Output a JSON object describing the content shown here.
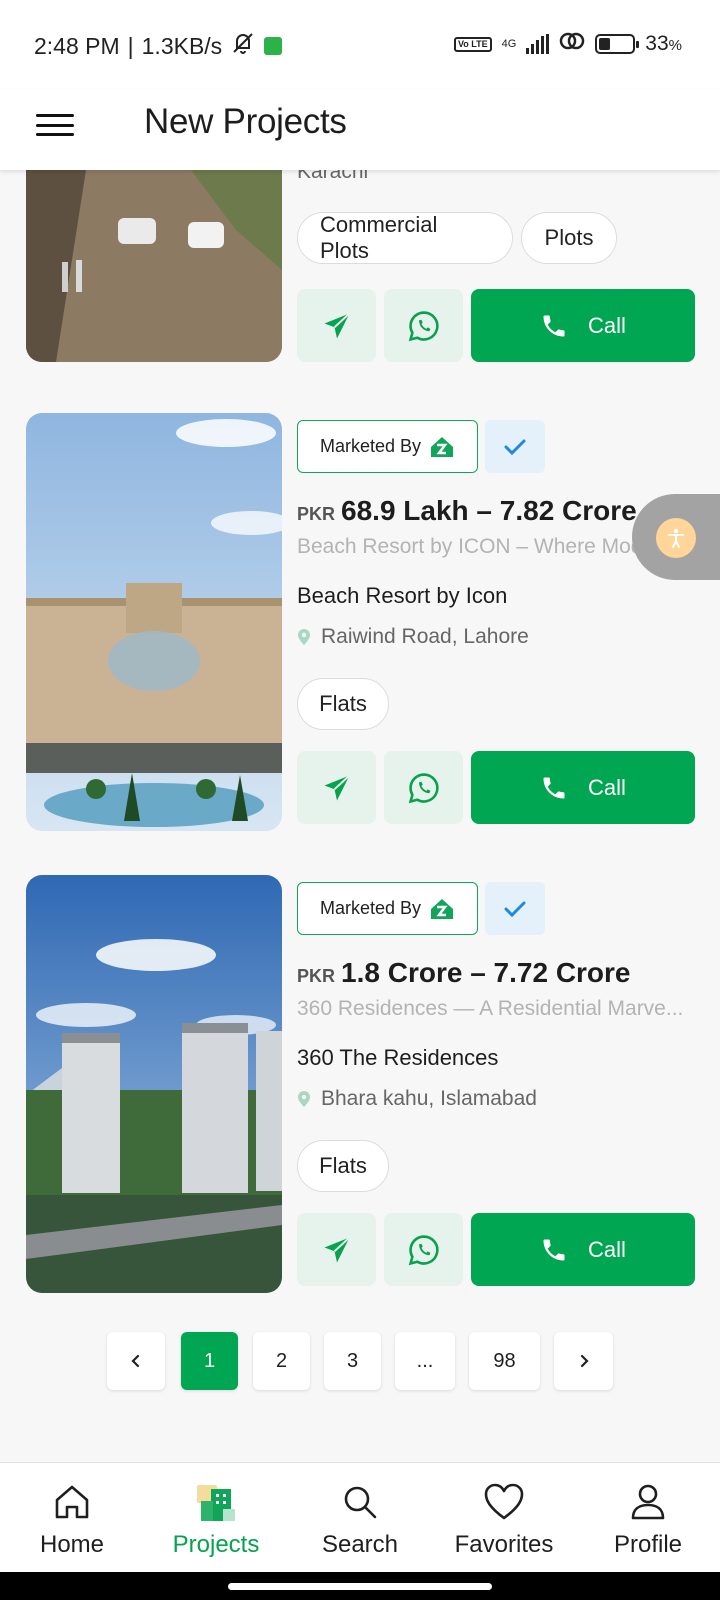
{
  "status_bar": {
    "time": "2:48 PM",
    "separator": "|",
    "speed": "1.3KB/s",
    "network": "4G",
    "volte": "Vo LTE",
    "battery_percent": "33",
    "battery_unit": "%",
    "battery_level": 0.33
  },
  "header": {
    "title": "New Projects",
    "menu_icon": "hamburger-menu-icon"
  },
  "listings": [
    {
      "location": "Karachi",
      "chips": [
        "Commercial Plots",
        "Plots"
      ],
      "call_label": "Call"
    },
    {
      "marketed_label": "Marketed By",
      "currency": "PKR",
      "price": "68.9 Lakh – 7.82 Crore",
      "tagline": "Beach Resort by ICON – Where Mode...",
      "name": "Beach Resort by Icon",
      "location": "Raiwind Road, Lahore",
      "chips": [
        "Flats"
      ],
      "call_label": "Call",
      "verified": true
    },
    {
      "marketed_label": "Marketed By",
      "currency": "PKR",
      "price": "1.8 Crore – 7.72 Crore",
      "tagline": "360 Residences — A Residential Marve...",
      "name": "360 The Residences",
      "location": "Bhara kahu, Islamabad",
      "chips": [
        "Flats"
      ],
      "call_label": "Call",
      "verified": true
    }
  ],
  "pagination": {
    "prev_icon": "chevron-left-icon",
    "next_icon": "chevron-right-icon",
    "pages": [
      "1",
      "2",
      "3",
      "...",
      "98"
    ],
    "current": "1"
  },
  "bottom_nav": {
    "items": [
      {
        "label": "Home",
        "icon": "home-icon"
      },
      {
        "label": "Projects",
        "icon": "projects-icon"
      },
      {
        "label": "Search",
        "icon": "search-icon"
      },
      {
        "label": "Favorites",
        "icon": "heart-icon"
      },
      {
        "label": "Profile",
        "icon": "profile-icon"
      }
    ],
    "active": "Projects"
  },
  "colors": {
    "brand_green": "#00a651",
    "action_bg": "#e6f2ec",
    "verify_bg": "#e4f1fb",
    "verify_check": "#1e88e5"
  }
}
